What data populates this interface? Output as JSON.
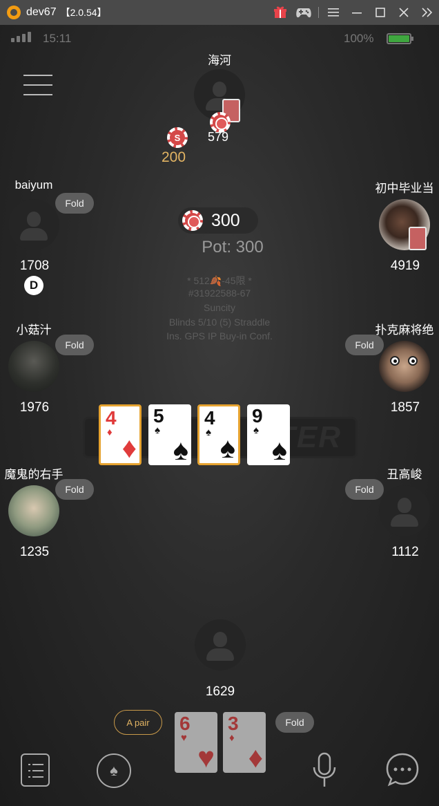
{
  "window": {
    "app_name": "dev67",
    "version": "【2.0.54】",
    "icons": [
      "gift-icon",
      "gamepad-icon",
      "menu-icon",
      "minimize-icon",
      "maximize-icon",
      "close-icon",
      "expand-icon"
    ]
  },
  "status_bar": {
    "time": "15:11",
    "battery_text": "100%",
    "battery_level": 1.0,
    "battery_color": "#3fa63f"
  },
  "top_player": {
    "name": "海河",
    "stack": "579"
  },
  "top_bet": {
    "chip_letter": "S",
    "amount": "200"
  },
  "pot": {
    "current_bet": "300",
    "label": "Pot: 300"
  },
  "table_info": {
    "line1": "* 512🍂-45限 *",
    "line2": "#31922588-67",
    "line3": "Suncity",
    "line4": "Blinds 5/10 (5)  Straddle",
    "line5": "Ins. GPS IP Buy-in Conf."
  },
  "watermark": "TER",
  "players": {
    "baiyum": {
      "name": "baiyum",
      "stack": "1708",
      "status": "Fold",
      "dealer": "D"
    },
    "chuzhong": {
      "name": "初中毕业当",
      "stack": "4919"
    },
    "xiaogu": {
      "name": "小菇汁",
      "stack": "1976",
      "status": "Fold"
    },
    "puke": {
      "name": "扑克麻将绝",
      "stack": "1857",
      "status": "Fold"
    },
    "mogui": {
      "name": "魔鬼的右手",
      "stack": "1235",
      "status": "Fold"
    },
    "chou": {
      "name": "丑高峻",
      "stack": "1112",
      "status": "Fold"
    },
    "hero": {
      "name": "",
      "stack": "1629",
      "status": "Fold",
      "hand_label": "A pair"
    }
  },
  "board": [
    {
      "rank": "4",
      "suit": "♦",
      "color": "red",
      "highlight": true
    },
    {
      "rank": "5",
      "suit": "♠",
      "color": "black",
      "highlight": false
    },
    {
      "rank": "4",
      "suit": "♠",
      "color": "black",
      "highlight": true
    },
    {
      "rank": "9",
      "suit": "♠",
      "color": "black",
      "highlight": false
    }
  ],
  "hero_cards": [
    {
      "rank": "6",
      "suit": "♥",
      "color": "red"
    },
    {
      "rank": "3",
      "suit": "♦",
      "color": "red"
    }
  ],
  "bottom_bar": [
    "list-icon",
    "spade-icon",
    "mic-icon",
    "chat-icon"
  ]
}
